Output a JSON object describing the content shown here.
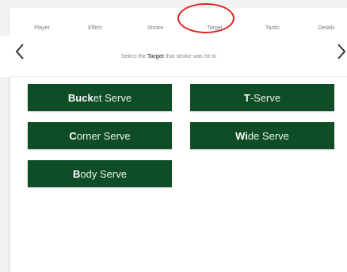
{
  "tabs": [
    {
      "label": "Player"
    },
    {
      "label": "Effect"
    },
    {
      "label": "Stroke"
    },
    {
      "label": "Target"
    },
    {
      "label": "Tactic"
    },
    {
      "label": "Details"
    }
  ],
  "instruction": {
    "prefix": "Select the ",
    "emphasis": "Target",
    "suffix": " that stroke was hit to"
  },
  "buttons": [
    {
      "accent": "Buck",
      "rest": "et Serve"
    },
    {
      "accent": "T",
      "rest": "-Serve"
    },
    {
      "accent": "C",
      "rest": "orner Serve"
    },
    {
      "accent": "Wi",
      "rest": "de Serve"
    },
    {
      "accent": "B",
      "rest": "ody Serve"
    }
  ],
  "colors": {
    "button_bg": "#0f4d27",
    "highlight_ring": "#e02020"
  },
  "icons": {
    "prev": "chevron-left-icon",
    "next": "chevron-right-icon"
  }
}
